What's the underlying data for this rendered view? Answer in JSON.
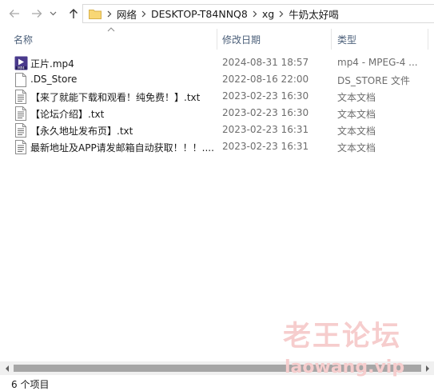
{
  "address_bar": {
    "crumbs": [
      "网络",
      "DESKTOP-T84NNQ8",
      "xg",
      "牛奶太好喝"
    ]
  },
  "columns": {
    "name": "名称",
    "date": "修改日期",
    "type": "类型"
  },
  "files": [
    {
      "name": "正片.mp4",
      "date": "2024-08-31 18:57",
      "type": "mp4 - MPEG-4 ...",
      "icon": "video-file-icon"
    },
    {
      "name": ".DS_Store",
      "date": "2022-08-16 22:00",
      "type": "DS_STORE 文件",
      "icon": "blank-file-icon"
    },
    {
      "name": "【来了就能下载和观看！纯免费！】.txt",
      "date": "2023-02-23 16:30",
      "type": "文本文档",
      "icon": "text-file-icon"
    },
    {
      "name": "【论坛介绍】.txt",
      "date": "2023-02-23 16:30",
      "type": "文本文档",
      "icon": "text-file-icon"
    },
    {
      "name": "【永久地址发布页】.txt",
      "date": "2023-02-23 16:31",
      "type": "文本文档",
      "icon": "text-file-icon"
    },
    {
      "name": "最新地址及APP请发邮箱自动获取！！！....",
      "date": "2023-02-23 16:31",
      "type": "文本文档",
      "icon": "text-file-icon"
    }
  ],
  "status": {
    "item_count": "6 个项目"
  },
  "watermark": {
    "text": "老王论坛",
    "url": "laowang.vip"
  },
  "colors": {
    "header_text": "#4c607a",
    "secondary_text": "#6d6d6d",
    "folder_yellow": "#f8d775",
    "watermark": "#f6cdcd"
  }
}
